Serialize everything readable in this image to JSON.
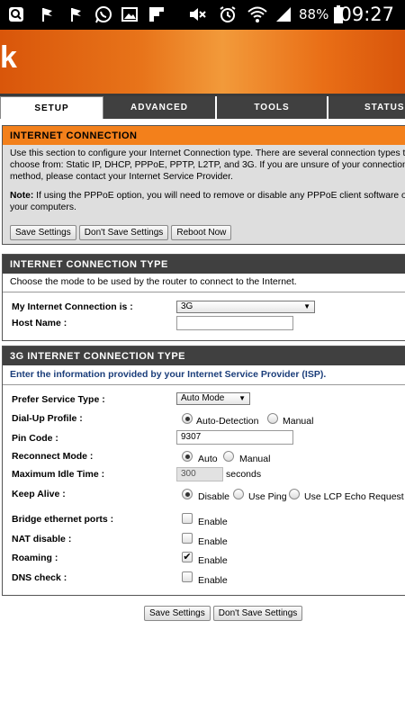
{
  "status_bar": {
    "battery": "88%",
    "time": "09:27",
    "icons": [
      "search-icon",
      "flag-icon",
      "flag-icon",
      "whatsapp-icon",
      "image-icon",
      "flipboard-icon",
      "mute-icon",
      "alarm-icon",
      "wifi-icon",
      "signal-icon",
      "battery-icon"
    ]
  },
  "banner": {
    "logo_fragment": "k"
  },
  "tabs": [
    "SETUP",
    "ADVANCED",
    "TOOLS",
    "STATUS"
  ],
  "internet_connection": {
    "title": "INTERNET CONNECTION",
    "description": "Use this section to configure your Internet Connection type. There are several connection types to choose from: Static IP, DHCP, PPPoE, PPTP, L2TP, and 3G. If you are unsure of your connection method, please contact your Internet Service Provider.",
    "note_label": "Note:",
    "note_text": " If using the PPPoE option, you will need to remove or disable any PPPoE client software on your computers.",
    "buttons": {
      "save": "Save Settings",
      "dont_save": "Don't Save Settings",
      "reboot": "Reboot Now"
    }
  },
  "connection_type": {
    "title": "INTERNET CONNECTION TYPE",
    "description": "Choose the mode to be used by the router to connect to the Internet.",
    "my_connection_label": "My Internet Connection is :",
    "my_connection_value": "3G",
    "host_name_label": "Host Name :",
    "host_name_value": ""
  },
  "g3": {
    "title": "3G INTERNET CONNECTION TYPE",
    "info": "Enter the information provided by your Internet Service Provider (ISP).",
    "prefer_service_label": "Prefer Service Type :",
    "prefer_service_value": "Auto Mode",
    "dialup_label": "Dial-Up Profile :",
    "dialup_opt1": "Auto-Detection",
    "dialup_opt2": "Manual",
    "pin_label": "Pin Code :",
    "pin_value": "9307",
    "reconnect_label": "Reconnect Mode :",
    "reconnect_opt1": "Auto",
    "reconnect_opt2": "Manual",
    "idle_label": "Maximum Idle Time :",
    "idle_value": "300",
    "idle_unit": "seconds",
    "keepalive_label": "Keep Alive :",
    "keepalive_opt1": "Disable",
    "keepalive_opt2": "Use Ping",
    "keepalive_opt3": "Use LCP Echo Request",
    "bridge_label": "Bridge ethernet ports :",
    "nat_label": "NAT disable :",
    "roaming_label": "Roaming :",
    "dns_label": "DNS check :",
    "enable_text": "Enable",
    "checks": {
      "bridge": false,
      "nat": false,
      "roaming": true,
      "dns": false
    }
  },
  "footer_buttons": {
    "save": "Save Settings",
    "dont_save": "Don't Save Settings"
  }
}
